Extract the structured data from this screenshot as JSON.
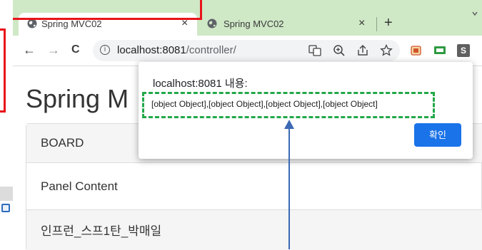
{
  "browser": {
    "tabs": [
      {
        "title": "Spring MVC02",
        "close": "×",
        "active": true
      },
      {
        "title": "Spring MVC02",
        "close": "×",
        "active": false
      }
    ],
    "new_tab": "+",
    "nav": {
      "back": "←",
      "forward": "→",
      "reload": "C"
    },
    "address": {
      "host": "localhost:8081",
      "path": "/controller/"
    },
    "icons": [
      "translate-icon",
      "zoom-icon",
      "share-icon",
      "bookmark-star-icon",
      "extension-icon",
      "cast-icon",
      "profile-s-icon"
    ],
    "profile_letter": "S"
  },
  "page": {
    "title": "Spring M",
    "panel_heading": "BOARD",
    "panel_body": "Panel Content",
    "footer": "인프런_스프1탄_박매일"
  },
  "dialog": {
    "title": "localhost:8081 내용:",
    "message": "[object Object],[object Object],[object Object],[object Object]",
    "ok_label": "확인"
  },
  "colors": {
    "tab_bar": "#cfe8c6",
    "annotation_red": "#e8141a",
    "annotation_green": "#22a84a",
    "annotation_arrow": "#3b69b4",
    "dialog_button": "#1a73e8"
  }
}
